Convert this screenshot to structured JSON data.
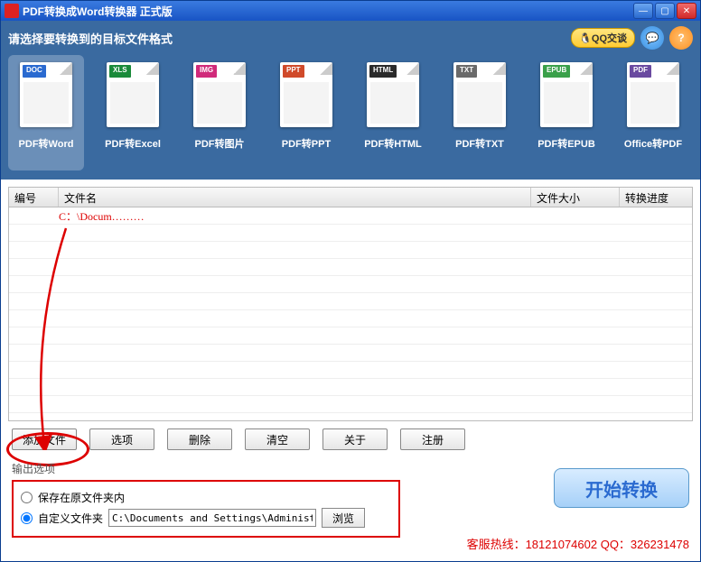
{
  "titlebar": {
    "text": "PDF转换成Word转换器 正式版"
  },
  "format_panel": {
    "title": "请选择要转换到的目标文件格式",
    "qq_label": "🐧QQ交谈",
    "items": [
      {
        "tag": "DOC",
        "tag_color": "#2a6ad0",
        "label": "PDF转Word"
      },
      {
        "tag": "XLS",
        "tag_color": "#1a8a3a",
        "label": "PDF转Excel"
      },
      {
        "tag": "IMG",
        "tag_color": "#d02a7a",
        "label": "PDF转图片"
      },
      {
        "tag": "PPT",
        "tag_color": "#d04a2a",
        "label": "PDF转PPT"
      },
      {
        "tag": "HTML",
        "tag_color": "#2a2a2a",
        "label": "PDF转HTML"
      },
      {
        "tag": "TXT",
        "tag_color": "#6a6a6a",
        "label": "PDF转TXT"
      },
      {
        "tag": "EPUB",
        "tag_color": "#3aa04a",
        "label": "PDF转EPUB"
      },
      {
        "tag": "PDF",
        "tag_color": "#6a4aa0",
        "label": "Office转PDF"
      }
    ]
  },
  "list": {
    "headers": {
      "num": "编号",
      "name": "文件名",
      "size": "文件大小",
      "progress": "转换进度"
    },
    "rows": [
      {
        "name": "  C：\\Docum………"
      }
    ]
  },
  "buttons": {
    "add": "添加文件",
    "options": "选项",
    "delete": "删除",
    "clear": "清空",
    "about": "关于",
    "register": "注册"
  },
  "output": {
    "title": "输出选项",
    "save_original": "保存在原文件夹内",
    "custom_folder": "自定义文件夹",
    "path": "C:\\Documents and Settings\\Administrator\\桌面",
    "browse": "浏览"
  },
  "start_label": "开始转换",
  "hotline": "客服热线：18121074602 QQ：326231478"
}
